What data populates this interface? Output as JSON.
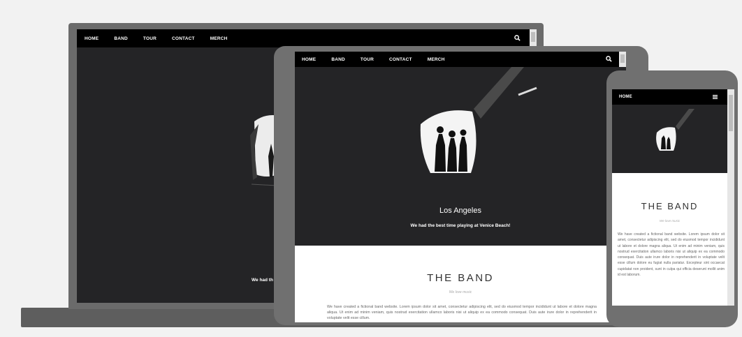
{
  "colors": {
    "background": "#f2f2f2",
    "device_frame": "#6b6b6b",
    "hero_background": "#242426",
    "navbar": "#000000",
    "nav_text": "#ffffff",
    "body_text": "#666666",
    "subtitle_text": "#a8a8a8"
  },
  "nav": {
    "items": [
      "HOME",
      "BAND",
      "TOUR",
      "CONTACT",
      "MERCH"
    ],
    "search_icon": "search-icon",
    "menu_icon": "hamburger-menu-icon"
  },
  "laptop": {
    "caption_partial": "We had th"
  },
  "tablet": {
    "city": "Los Angeles",
    "caption": "We had the best time playing at Venice Beach!",
    "band_title": "THE BAND",
    "band_subtitle": "We love music",
    "band_text": "We have created a fictional band website. Lorem ipsum dolor sit amet, consectetur adipiscing elit, sed do eiusmod tempor incididunt ut labore et dolore magna aliqua. Ut enim ad minim veniam, quis nostrud exercitation ullamco laboris nisi ut aliquip ex ea commodo consequat. Duis aute irure dolor in reprehenderit in voluptate velit esse cillum."
  },
  "phone": {
    "nav_home": "HOME",
    "band_title": "THE BAND",
    "band_subtitle": "We love music",
    "band_text": "We have created a fictional band website. Lorem ipsum dolor sit amet, consectetur adipiscing elit, sed do eiusmod tempor incididunt ut labore et dolore magna aliqua. Ut enim ad minim veniam, quis nostrud exercitation ullamco laboris nisi ut aliquip ex ea commodo consequat. Duis aute irure dolor in reprehenderit in voluptate velit esse cillum dolore eu fugiat nulla pariatur. Excepteur sint occaecat cupidatat non proident, sunt in culpa qui officia deserunt mollit anim id est laborum."
  }
}
